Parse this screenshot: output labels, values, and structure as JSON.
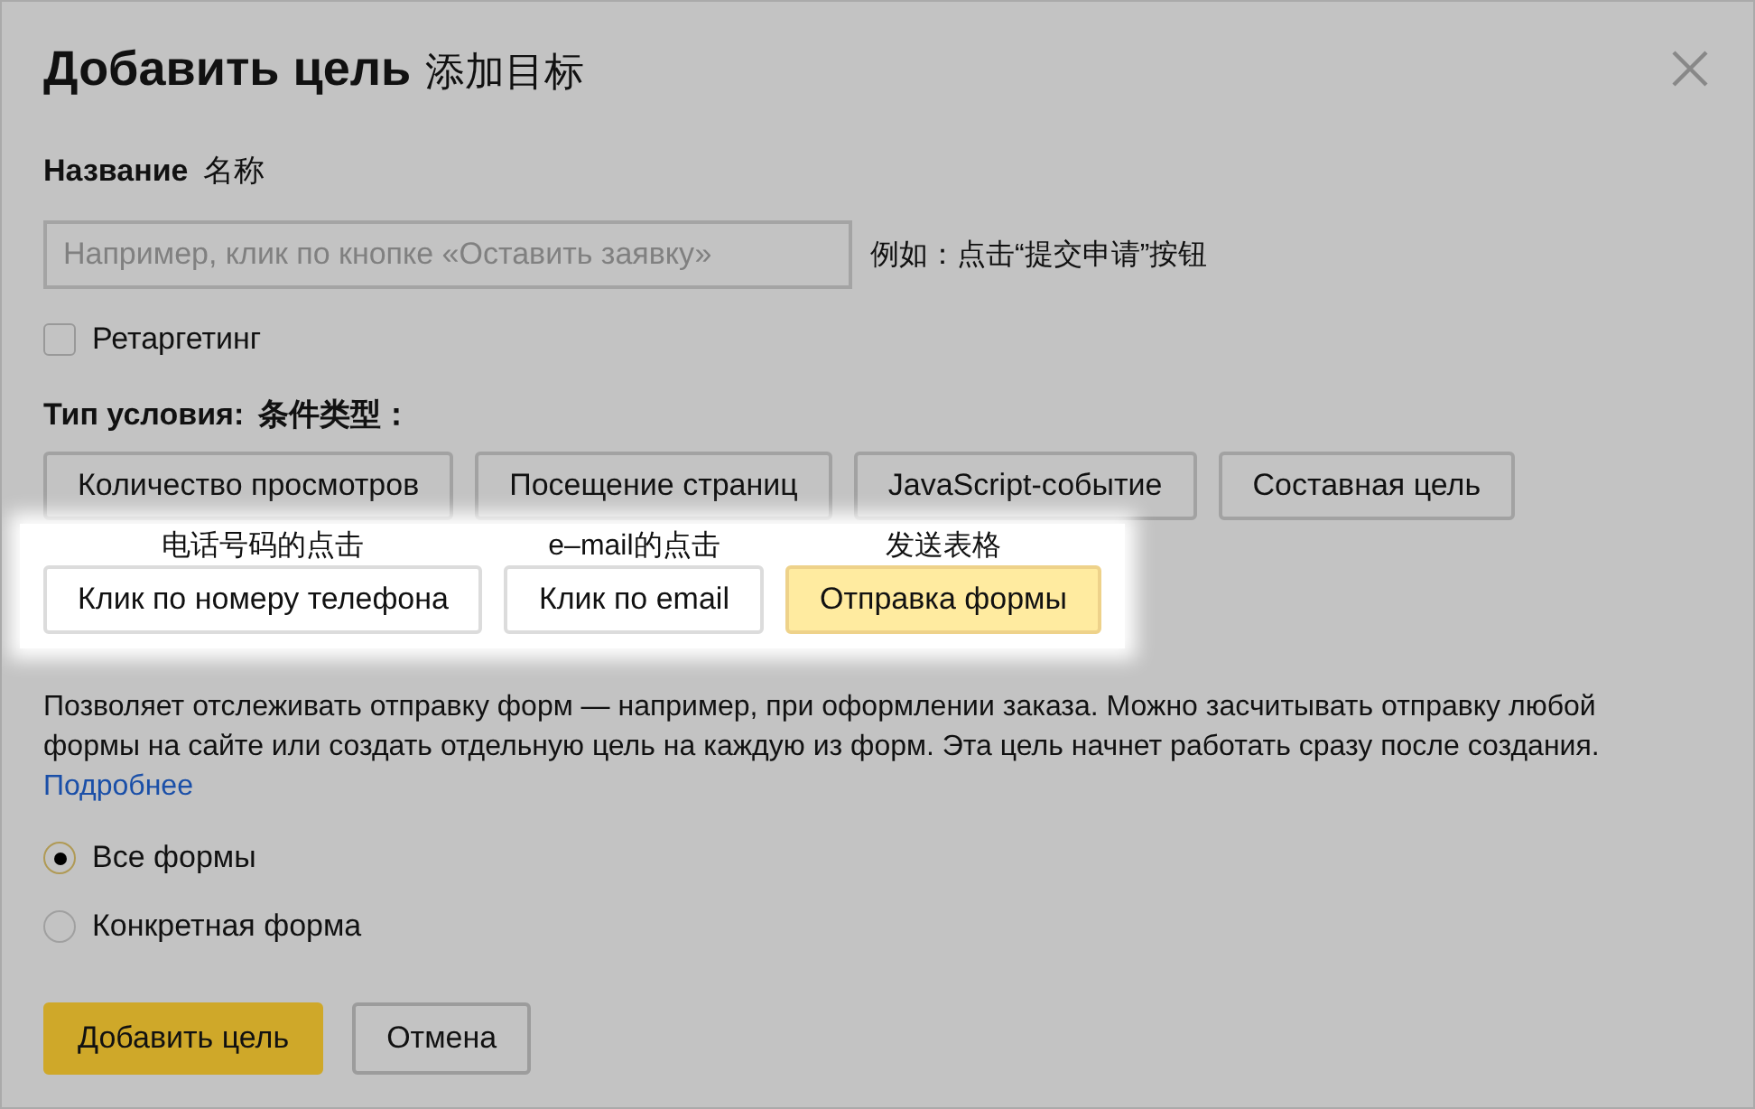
{
  "dialog": {
    "title": "Добавить цель",
    "title_note": "添加目标"
  },
  "name": {
    "label": "Название",
    "note": "名称",
    "placeholder": "Например, клик по кнопке «Оставить заявку»",
    "field_note": "例如：点击“提交申请”按钮"
  },
  "retargeting": {
    "label": "Ретаргетинг",
    "checked": false
  },
  "condition": {
    "label": "Тип условия:",
    "note": "条件类型："
  },
  "condition_types": [
    {
      "label": "Количество просмотров",
      "selected": false
    },
    {
      "label": "Посещение страниц",
      "selected": false
    },
    {
      "label": "JavaScript-событие",
      "selected": false
    },
    {
      "label": "Составная цель",
      "selected": false
    }
  ],
  "highlighted_types": [
    {
      "label": "Клик по номеру телефона",
      "note": "电话号码的点击",
      "selected": false
    },
    {
      "label": "Клик по email",
      "note": "e–mail的点击",
      "selected": false
    },
    {
      "label": "Отправка формы",
      "note": "发送表格",
      "selected": true
    }
  ],
  "description": {
    "text": "Позволяет отслеживать отправку форм — например, при оформлении заказа. Можно засчитывать отправку любой формы на сайте или создать отдельную цель на каждую из форм. Эта цель начнет работать сразу после создания.",
    "link": "Подробнее"
  },
  "forms": [
    {
      "label": "Все формы",
      "selected": true
    },
    {
      "label": "Конкретная форма",
      "selected": false
    }
  ],
  "buttons": [
    {
      "label": "Добавить цель",
      "kind": "primary"
    },
    {
      "label": "Отмена",
      "kind": "secondary"
    }
  ]
}
